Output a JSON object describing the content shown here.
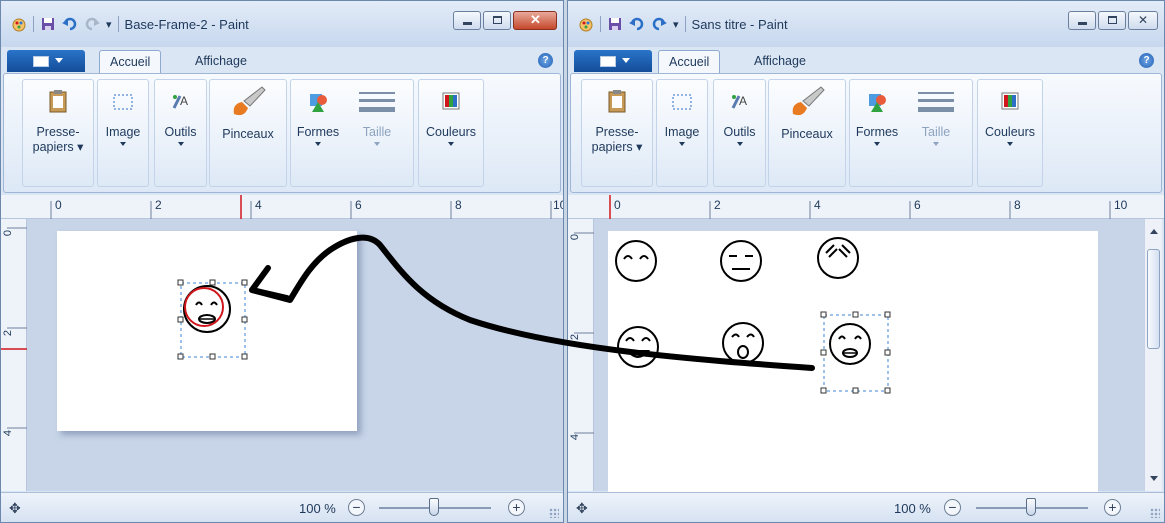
{
  "window1": {
    "title": "Base-Frame-2 - Paint",
    "tabs": [
      "Accueil",
      "Affichage"
    ],
    "groups": {
      "clipboard": [
        "Presse-",
        "papiers"
      ],
      "image": "Image",
      "tools": "Outils",
      "brushes": "Pinceaux",
      "shapes": "Formes",
      "size": "Taille",
      "colors": "Couleurs"
    },
    "ruler_h": [
      "0",
      "2",
      "4",
      "6",
      "8",
      "10"
    ],
    "ruler_v": [
      "0",
      "2",
      "4"
    ],
    "zoom": "100 %"
  },
  "window2": {
    "title": "Sans titre - Paint",
    "tabs": [
      "Accueil",
      "Affichage"
    ],
    "groups": {
      "clipboard": [
        "Presse-",
        "papiers"
      ],
      "image": "Image",
      "tools": "Outils",
      "brushes": "Pinceaux",
      "shapes": "Formes",
      "size": "Taille",
      "colors": "Couleurs"
    },
    "ruler_h": [
      "0",
      "2",
      "4",
      "6",
      "8",
      "10"
    ],
    "ruler_v": [
      "0",
      "2",
      "4"
    ],
    "zoom": "100 %"
  },
  "icons": {
    "paint_app": "paint-app-icon",
    "save": "save-icon",
    "undo": "undo-icon",
    "redo": "redo-icon",
    "customize": "customize-qa-icon",
    "minimize": "minimize-icon",
    "maximize": "maximize-icon",
    "close": "close-icon",
    "help": "help-icon",
    "move": "move-icon"
  },
  "colors": {
    "accent": "#1e5fb4",
    "close_button": "#c4482b",
    "drag_arrow": "#000000",
    "highlight_circle": "#d0161c"
  }
}
